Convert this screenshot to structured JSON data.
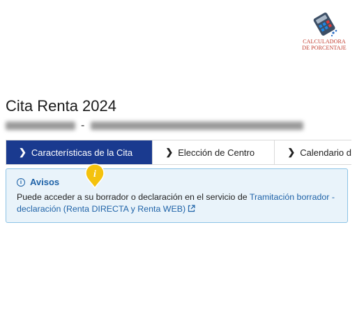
{
  "logo": {
    "line1": "CALCULADORA",
    "line2": "DE PORCENTAJE"
  },
  "page": {
    "title": "Cita Renta 2024",
    "subtitle_separator": "-"
  },
  "tabs": [
    {
      "label": "Características de la Cita",
      "active": true
    },
    {
      "label": "Elección de Centro",
      "active": false
    },
    {
      "label": "Calendario d",
      "active": false
    }
  ],
  "notice": {
    "title": "Avisos",
    "body_prefix": "Puede acceder a su borrador o declaración en el servicio de ",
    "link_text": "Tramitación borrador - declaración (Renta DIRECTA y Renta WEB)"
  },
  "icons": {
    "chevron": "chevron-right-icon",
    "info": "info-circle-icon",
    "external": "external-link-icon",
    "marker": "info-pin-icon"
  },
  "colors": {
    "active_tab": "#1a3a8f",
    "link": "#1f63a8",
    "notice_bg": "#e9f3fa",
    "notice_border": "#8cc3e6",
    "logo_text": "#c0392b",
    "pin": "#f4c20d"
  }
}
